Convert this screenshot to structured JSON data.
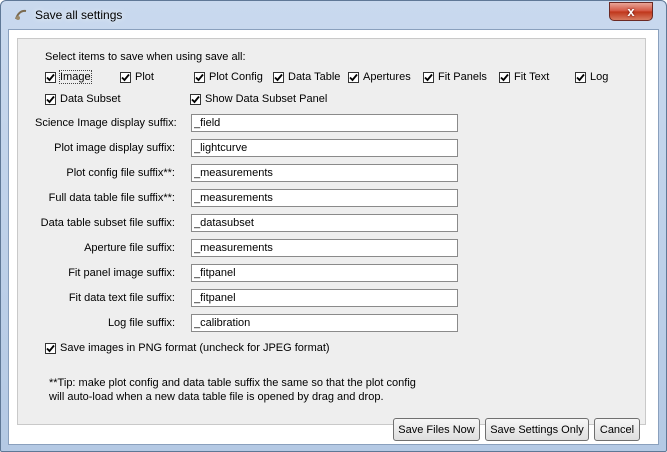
{
  "window": {
    "title": "Save all settings",
    "close_glyph": "x"
  },
  "intro": "Select items to save when using save all:",
  "items": [
    {
      "label": "Image",
      "checked": true
    },
    {
      "label": "Plot",
      "checked": true
    },
    {
      "label": "Plot Config",
      "checked": true
    },
    {
      "label": "Data Table",
      "checked": true
    },
    {
      "label": "Apertures",
      "checked": true
    },
    {
      "label": "Fit Panels",
      "checked": true
    },
    {
      "label": "Fit Text",
      "checked": true
    },
    {
      "label": "Log",
      "checked": true
    },
    {
      "label": "Data Subset",
      "checked": true
    },
    {
      "label": "Show Data Subset Panel",
      "checked": true
    }
  ],
  "suffixes": [
    {
      "label": "Science Image display suffix:",
      "value": "_field"
    },
    {
      "label": "Plot image display suffix:",
      "value": "_lightcurve"
    },
    {
      "label": "Plot config file suffix**:",
      "value": "_measurements"
    },
    {
      "label": "Full data table file suffix**:",
      "value": "_measurements"
    },
    {
      "label": "Data table subset file suffix:",
      "value": "_datasubset"
    },
    {
      "label": "Aperture file suffix:",
      "value": "_measurements"
    },
    {
      "label": "Fit panel image suffix:",
      "value": "_fitpanel"
    },
    {
      "label": "Fit data text file suffix:",
      "value": "_fitpanel"
    },
    {
      "label": "Log file suffix:",
      "value": "_calibration"
    }
  ],
  "png_option": {
    "label": "Save images in PNG format (uncheck for JPEG format)",
    "checked": true
  },
  "tip": {
    "line1": "**Tip: make plot config and data table suffix the same so that the plot config",
    "line2": "will auto-load when a new data table file is opened by drag and drop."
  },
  "buttons": {
    "save_files_now": "Save Files Now",
    "save_settings_only": "Save Settings Only",
    "cancel": "Cancel"
  },
  "colors": {
    "titlebar": "#b4c9e4",
    "close_button": "#c8432a",
    "panel": "#eeeeee"
  }
}
